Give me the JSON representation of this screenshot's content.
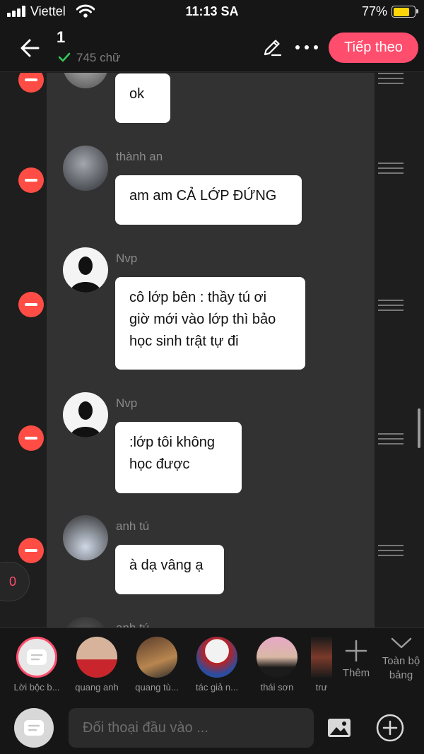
{
  "status_bar": {
    "carrier": "Viettel",
    "time": "11:13 SA",
    "battery": "77%",
    "battery_level": 0.77
  },
  "header": {
    "title": "1",
    "word_count": "745 chữ",
    "next_label": "Tiếp theo"
  },
  "messages": [
    {
      "sender": "",
      "text": "ok"
    },
    {
      "sender": "thành an",
      "text": "am am CẢ LỚP ĐỨNG"
    },
    {
      "sender": "Nvp",
      "text": "cô lớp bên : thầy tú ơi\ngiờ mới vào lớp thì bảo\nhọc sinh trật tự đi"
    },
    {
      "sender": "Nvp",
      "text": ":lớp tôi không\nhọc được"
    },
    {
      "sender": "anh tú",
      "text": "à dạ vâng ạ"
    },
    {
      "sender": "anh tú",
      "text": ""
    }
  ],
  "counter": "0",
  "characters": [
    {
      "name": "Lời bộc b..."
    },
    {
      "name": "quang anh"
    },
    {
      "name": "quang tù..."
    },
    {
      "name": "tác giả n..."
    },
    {
      "name": "thái sơn"
    },
    {
      "name": "trư"
    }
  ],
  "add_label": "Thêm",
  "all_label": "Toàn bộ bảng",
  "input": {
    "placeholder": "Đối thoại đầu vào ..."
  },
  "colors": {
    "accent": "#ff4d6d",
    "remove": "#ff4d45",
    "check": "#34c759",
    "battery": "#ffd60a"
  },
  "icons": [
    "back-arrow-icon",
    "check-icon",
    "pencil-icon",
    "more-icon",
    "minus-icon",
    "drag-handle-icon",
    "plus-icon",
    "chevron-down-icon",
    "image-icon",
    "add-circle-icon",
    "narration-icon"
  ]
}
